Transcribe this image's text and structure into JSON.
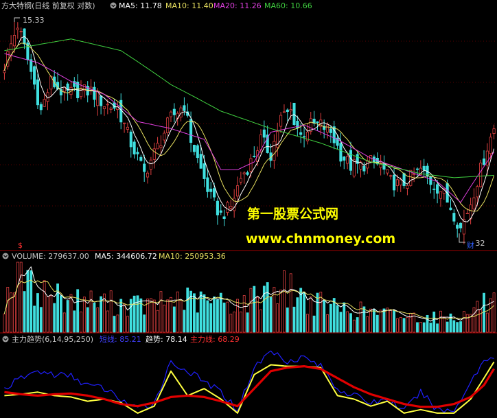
{
  "colors": {
    "background": "#000000",
    "divider": "#a00000",
    "grid": "#5a0000",
    "up": "#e04040",
    "down": "#40e0e0",
    "ma5": "#ffffff",
    "ma10": "#e8e060",
    "ma20": "#e040e0",
    "ma60": "#40d040",
    "short_line": "#2020ff",
    "trend_line": "#ffff40",
    "main_line": "#e00000",
    "watermark": "#ffff00"
  },
  "header": {
    "title": "方大特钢(日线 前复权 对数)",
    "ma5_label": "MA5: 11.78",
    "ma10_label": "MA10: 11.40",
    "ma20_label": "MA20: 11.26",
    "ma60_label": "MA60: 10.66"
  },
  "price_panel": {
    "high_marker": "15.33",
    "low_marker": "9.32",
    "low_badge": "财",
    "dollar_marker": "$"
  },
  "volume_panel": {
    "label": "VOLUME: 279637.00",
    "ma5_label": "MA5: 344606.72",
    "ma10_label": "MA10: 250953.36"
  },
  "indicator_panel": {
    "name": "主力趋势(6,14,95,250)",
    "short_label": "短线: 85.21",
    "trend_label": "趋势: 78.14",
    "main_label": "主力线: 68.29"
  },
  "watermark": {
    "line1": "第一股票公式网",
    "line2": "www.chnmoney.com"
  },
  "chart_data": [
    {
      "type": "candlestick",
      "panel": "price",
      "title": "方大特钢(日线 前复权 对数)",
      "y_scale": "log",
      "ylim": [
        9.0,
        15.6
      ],
      "annotations": [
        {
          "label": "15.33",
          "index": 3,
          "value": 15.33
        },
        {
          "label": "9.32",
          "index": 137,
          "value": 9.32
        }
      ],
      "close_path": [
        [
          0,
          13.8
        ],
        [
          4,
          15.2
        ],
        [
          7,
          14.0
        ],
        [
          11,
          12.4
        ],
        [
          14,
          13.3
        ],
        [
          18,
          12.9
        ],
        [
          22,
          13.0
        ],
        [
          26,
          13.0
        ],
        [
          30,
          12.6
        ],
        [
          34,
          12.5
        ],
        [
          38,
          11.5
        ],
        [
          42,
          10.7
        ],
        [
          46,
          11.4
        ],
        [
          50,
          12.2
        ],
        [
          54,
          12.6
        ],
        [
          56,
          11.6
        ],
        [
          59,
          10.8
        ],
        [
          62,
          10.1
        ],
        [
          65,
          9.7
        ],
        [
          68,
          9.9
        ],
        [
          71,
          10.6
        ],
        [
          74,
          11.0
        ],
        [
          77,
          11.6
        ],
        [
          80,
          11.2
        ],
        [
          83,
          12.2
        ],
        [
          86,
          12.4
        ],
        [
          89,
          11.7
        ],
        [
          92,
          12.0
        ],
        [
          95,
          12.0
        ],
        [
          98,
          11.8
        ],
        [
          101,
          11.2
        ],
        [
          104,
          10.9
        ],
        [
          107,
          10.9
        ],
        [
          110,
          11.0
        ],
        [
          113,
          10.9
        ],
        [
          116,
          10.5
        ],
        [
          119,
          10.4
        ],
        [
          122,
          10.6
        ],
        [
          125,
          10.8
        ],
        [
          128,
          10.5
        ],
        [
          131,
          10.3
        ],
        [
          134,
          9.9
        ],
        [
          137,
          9.4
        ],
        [
          140,
          10.0
        ],
        [
          143,
          10.8
        ],
        [
          145,
          11.4
        ],
        [
          147,
          11.9
        ]
      ],
      "series": [
        {
          "name": "MA5",
          "value": 11.78
        },
        {
          "name": "MA10",
          "value": 11.4
        },
        {
          "name": "MA20",
          "value": 11.26
        },
        {
          "name": "MA60",
          "value": 10.66
        }
      ],
      "ma60_path": [
        [
          0,
          14.3
        ],
        [
          20,
          14.7
        ],
        [
          35,
          14.3
        ],
        [
          50,
          13.2
        ],
        [
          65,
          12.4
        ],
        [
          80,
          11.9
        ],
        [
          95,
          11.5
        ],
        [
          110,
          11.0
        ],
        [
          125,
          10.7
        ],
        [
          135,
          10.6
        ],
        [
          147,
          10.66
        ]
      ],
      "ma20_path": [
        [
          0,
          14.2
        ],
        [
          10,
          13.9
        ],
        [
          20,
          13.3
        ],
        [
          30,
          12.9
        ],
        [
          40,
          12.1
        ],
        [
          50,
          11.9
        ],
        [
          60,
          11.6
        ],
        [
          65,
          10.8
        ],
        [
          70,
          10.8
        ],
        [
          75,
          11.0
        ],
        [
          80,
          11.8
        ],
        [
          90,
          12.0
        ],
        [
          100,
          11.6
        ],
        [
          110,
          11.1
        ],
        [
          120,
          10.8
        ],
        [
          130,
          10.5
        ],
        [
          137,
          10.0
        ],
        [
          147,
          11.26
        ]
      ]
    },
    {
      "type": "bar",
      "panel": "volume",
      "series": [
        {
          "name": "VOLUME",
          "value": 279637.0
        },
        {
          "name": "MA5",
          "value": 344606.72
        },
        {
          "name": "MA10",
          "value": 250953.36
        }
      ],
      "volume_path": [
        [
          0,
          310000
        ],
        [
          4,
          650000
        ],
        [
          8,
          440000
        ],
        [
          14,
          380000
        ],
        [
          20,
          320000
        ],
        [
          28,
          300000
        ],
        [
          36,
          280000
        ],
        [
          44,
          260000
        ],
        [
          52,
          340000
        ],
        [
          58,
          300000
        ],
        [
          66,
          300000
        ],
        [
          72,
          280000
        ],
        [
          80,
          460000
        ],
        [
          86,
          420000
        ],
        [
          92,
          300000
        ],
        [
          100,
          240000
        ],
        [
          110,
          200000
        ],
        [
          120,
          160000
        ],
        [
          130,
          150000
        ],
        [
          138,
          160000
        ],
        [
          143,
          280000
        ],
        [
          147,
          279637
        ]
      ]
    },
    {
      "type": "line",
      "panel": "indicator",
      "title": "主力趋势(6,14,95,250)",
      "ylim": [
        0,
        100
      ],
      "series": [
        {
          "name": "短线",
          "value": 85.21,
          "path": [
            [
              0,
              40
            ],
            [
              5,
              55
            ],
            [
              10,
              65
            ],
            [
              15,
              60
            ],
            [
              20,
              58
            ],
            [
              25,
              45
            ],
            [
              30,
              40
            ],
            [
              35,
              25
            ],
            [
              40,
              10
            ],
            [
              45,
              20
            ],
            [
              50,
              78
            ],
            [
              55,
              65
            ],
            [
              60,
              50
            ],
            [
              65,
              35
            ],
            [
              70,
              10
            ],
            [
              75,
              70
            ],
            [
              80,
              94
            ],
            [
              85,
              80
            ],
            [
              90,
              85
            ],
            [
              95,
              72
            ],
            [
              100,
              40
            ],
            [
              105,
              30
            ],
            [
              110,
              20
            ],
            [
              115,
              25
            ],
            [
              120,
              8
            ],
            [
              125,
              35
            ],
            [
              130,
              10
            ],
            [
              135,
              8
            ],
            [
              140,
              50
            ],
            [
              144,
              80
            ],
            [
              147,
              85.21
            ]
          ]
        },
        {
          "name": "趋势",
          "value": 78.14,
          "path": [
            [
              0,
              30
            ],
            [
              5,
              32
            ],
            [
              10,
              35
            ],
            [
              15,
              30
            ],
            [
              20,
              28
            ],
            [
              25,
              22
            ],
            [
              30,
              25
            ],
            [
              35,
              20
            ],
            [
              40,
              5
            ],
            [
              45,
              15
            ],
            [
              50,
              65
            ],
            [
              55,
              30
            ],
            [
              60,
              40
            ],
            [
              65,
              25
            ],
            [
              70,
              5
            ],
            [
              75,
              60
            ],
            [
              80,
              74
            ],
            [
              85,
              72
            ],
            [
              90,
              72
            ],
            [
              95,
              70
            ],
            [
              100,
              30
            ],
            [
              105,
              25
            ],
            [
              110,
              15
            ],
            [
              115,
              22
            ],
            [
              120,
              5
            ],
            [
              125,
              10
            ],
            [
              130,
              5
            ],
            [
              135,
              5
            ],
            [
              140,
              25
            ],
            [
              144,
              55
            ],
            [
              147,
              78.14
            ]
          ]
        },
        {
          "name": "主力线",
          "value": 68.29,
          "path": [
            [
              0,
              35
            ],
            [
              5,
              32
            ],
            [
              10,
              30
            ],
            [
              15,
              32
            ],
            [
              20,
              33
            ],
            [
              25,
              30
            ],
            [
              30,
              25
            ],
            [
              35,
              18
            ],
            [
              40,
              15
            ],
            [
              45,
              20
            ],
            [
              50,
              28
            ],
            [
              55,
              30
            ],
            [
              60,
              28
            ],
            [
              65,
              22
            ],
            [
              70,
              15
            ],
            [
              75,
              40
            ],
            [
              80,
              65
            ],
            [
              85,
              70
            ],
            [
              90,
              72
            ],
            [
              95,
              68
            ],
            [
              100,
              55
            ],
            [
              105,
              42
            ],
            [
              110,
              32
            ],
            [
              115,
              25
            ],
            [
              120,
              18
            ],
            [
              125,
              14
            ],
            [
              130,
              14
            ],
            [
              135,
              18
            ],
            [
              140,
              28
            ],
            [
              144,
              45
            ],
            [
              147,
              68.29
            ]
          ]
        }
      ]
    }
  ]
}
